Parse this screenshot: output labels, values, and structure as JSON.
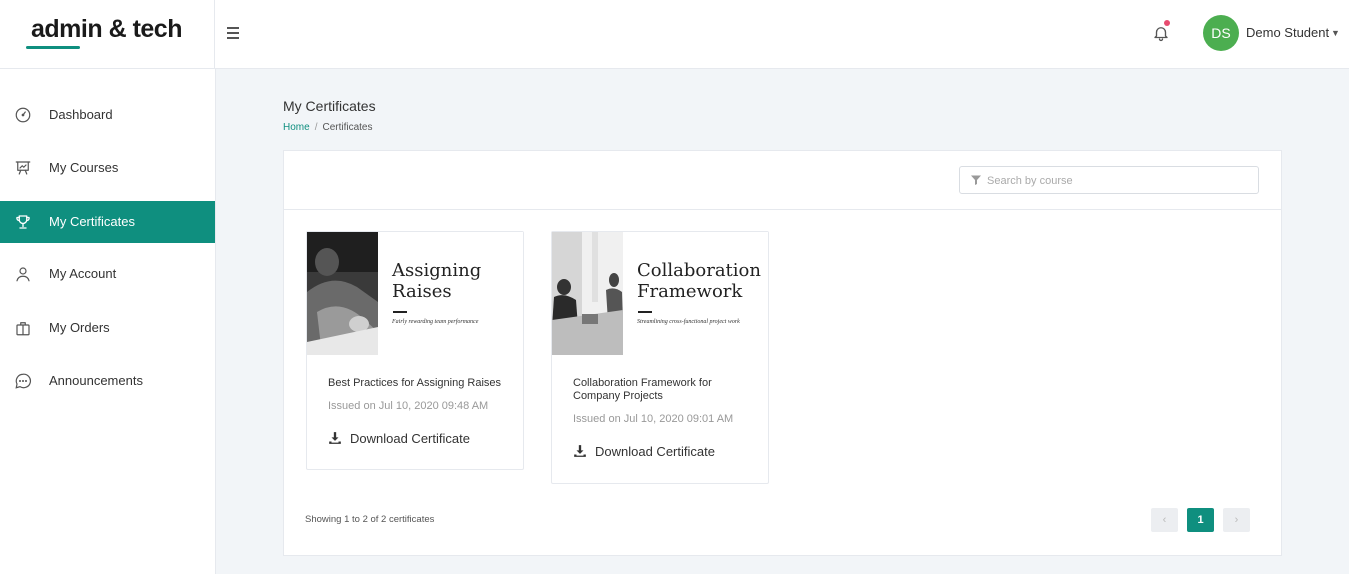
{
  "header": {
    "logo": "admin & tech",
    "user": {
      "initials": "DS",
      "name": "Demo Student"
    },
    "colors": {
      "accent": "#0f8f7f",
      "avatar": "#4cae50",
      "notification": "#e74c6f"
    }
  },
  "sidebar": {
    "items": [
      {
        "label": "Dashboard",
        "icon": "dashboard-icon",
        "active": false
      },
      {
        "label": "My Courses",
        "icon": "presentation-icon",
        "active": false
      },
      {
        "label": "My Certificates",
        "icon": "trophy-icon",
        "active": true
      },
      {
        "label": "My Account",
        "icon": "user-icon",
        "active": false
      },
      {
        "label": "My Orders",
        "icon": "bag-icon",
        "active": false
      },
      {
        "label": "Announcements",
        "icon": "chat-icon",
        "active": false
      }
    ]
  },
  "main": {
    "title": "My Certificates",
    "breadcrumb": {
      "home": "Home",
      "current": "Certificates"
    },
    "search": {
      "placeholder": "Search by course",
      "value": ""
    },
    "cards": [
      {
        "thumb_title_line1": "Assigning",
        "thumb_title_line2": "Raises",
        "thumb_subtitle": "Fairly rewarding team performance",
        "name": "Best Practices for Assigning Raises",
        "issued": "Issued on Jul 10, 2020 09:48 AM",
        "download_label": "Download Certificate"
      },
      {
        "thumb_title_line1": "Collaboration",
        "thumb_title_line2": "Framework",
        "thumb_subtitle": "Streamlining cross-functional project work",
        "name": "Collaboration Framework for Company Projects",
        "issued": "Issued on Jul 10, 2020 09:01 AM",
        "download_label": "Download Certificate"
      }
    ],
    "showing": "Showing 1 to 2 of 2 certificates",
    "pagination": {
      "current_page": "1",
      "prev": "‹",
      "next": "›"
    }
  }
}
